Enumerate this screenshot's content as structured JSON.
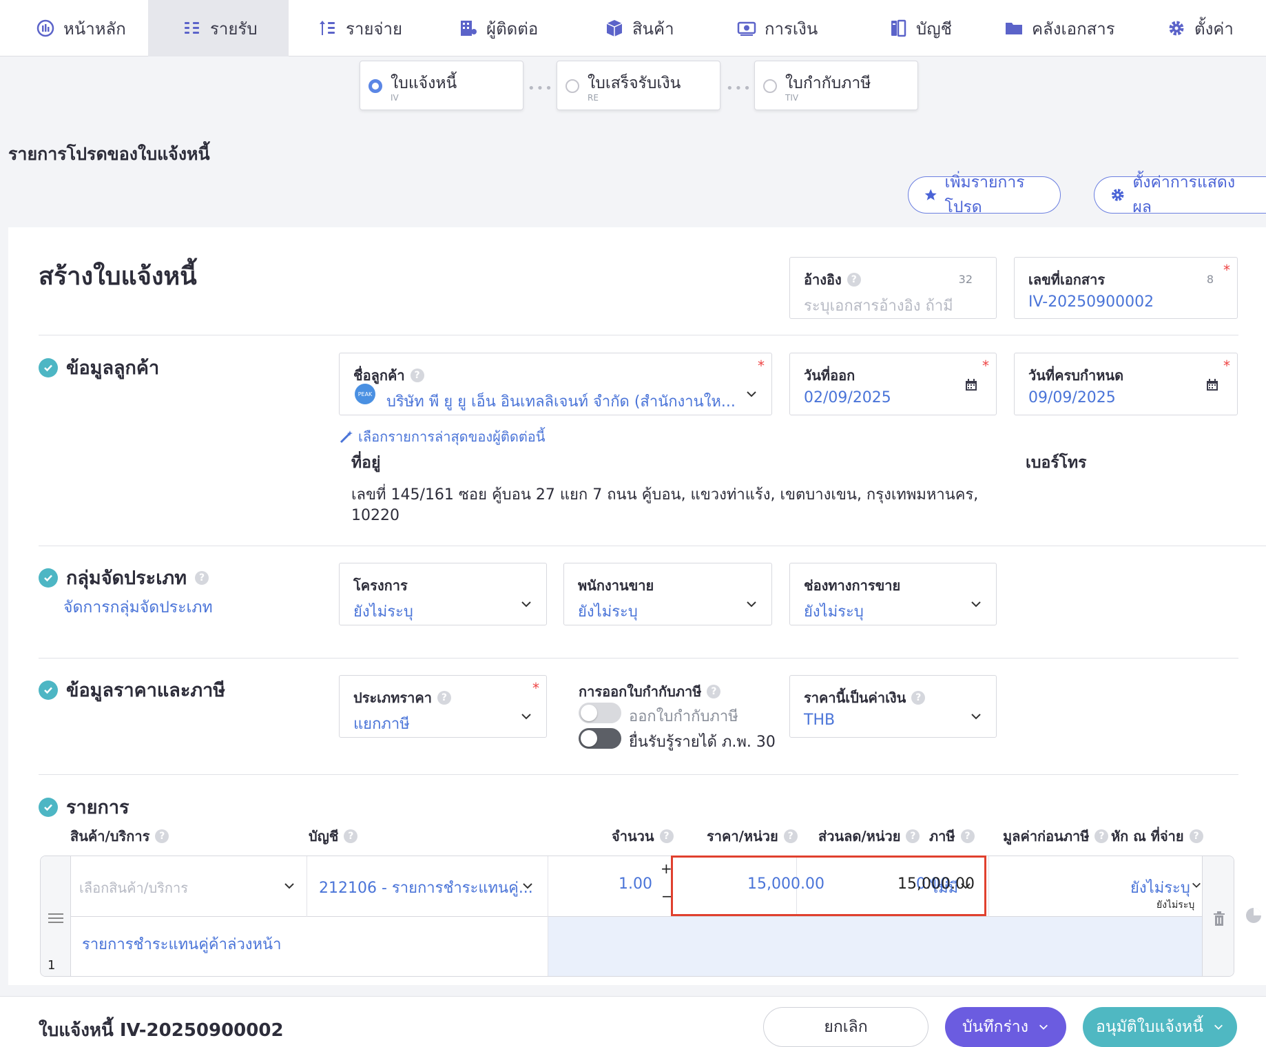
{
  "nav": {
    "items": [
      {
        "label": "หน้าหลัก",
        "icon": "dashboard-icon"
      },
      {
        "label": "รายรับ",
        "icon": "income-icon"
      },
      {
        "label": "รายจ่าย",
        "icon": "expense-icon"
      },
      {
        "label": "ผู้ติดต่อ",
        "icon": "contacts-icon"
      },
      {
        "label": "สินค้า",
        "icon": "box-icon"
      },
      {
        "label": "การเงิน",
        "icon": "money-icon"
      },
      {
        "label": "บัญชี",
        "icon": "ledger-icon"
      },
      {
        "label": "คลังเอกสาร",
        "icon": "folder-icon"
      },
      {
        "label": "ตั้งค่า",
        "icon": "gear-icon"
      }
    ],
    "active": "รายรับ"
  },
  "steps": [
    {
      "label": "ใบแจ้งหนี้",
      "code": "IV",
      "active": true
    },
    {
      "label": "ใบเสร็จรับเงิน",
      "code": "RE",
      "active": false
    },
    {
      "label": "ใบกำกับภาษี",
      "code": "TIV",
      "active": false
    }
  ],
  "favorites": {
    "title": "รายการโปรดของใบแจ้งหนี้",
    "add_label": "เพิ่มรายการโปรด",
    "settings_label": "ตั้งค่าการแสดงผล"
  },
  "page_title": "สร้างใบแจ้งหนี้",
  "header_fields": {
    "reference": {
      "label": "อ้างอิง",
      "placeholder": "ระบุเอกสารอ้างอิง ถ้ามี",
      "count": "32"
    },
    "doc_number": {
      "label": "เลขที่เอกสาร",
      "value": "IV-20250900002",
      "count": "8"
    }
  },
  "customer": {
    "section_title": "ข้อมูลลูกค้า",
    "name_label": "ชื่อลูกค้า",
    "name_value": "บริษัท พี ยู ยู เอ็น อินเทลลิเจนท์ จำกัด (สำนักงานให...",
    "avatar_text": "PEAK",
    "issue_date_label": "วันที่ออก",
    "issue_date": "02/09/2025",
    "due_date_label": "วันที่ครบกำหนด",
    "due_date": "09/09/2025",
    "recent_link": "เลือกรายการล่าสุดของผู้ติดต่อนี้",
    "address_label": "ที่อยู่",
    "address_line1": "เลขที่ 145/161 ซอย คู้บอน 27 แยก 7 ถนน คู้บอน, แขวงท่าแร้ง, เขตบางเขน, กรุงเทพมหานคร,",
    "address_line2": "10220",
    "phone_label": "เบอร์โทร"
  },
  "classification": {
    "section_title": "กลุ่มจัดประเภท",
    "manage_link": "จัดการกลุ่มจัดประเภท",
    "project_label": "โครงการ",
    "project_value": "ยังไม่ระบุ",
    "salesperson_label": "พนักงานขาย",
    "salesperson_value": "ยังไม่ระบุ",
    "channel_label": "ช่องทางการขาย",
    "channel_value": "ยังไม่ระบุ"
  },
  "pricing": {
    "section_title": "ข้อมูลราคาและภาษี",
    "price_type_label": "ประเภทราคา",
    "price_type_value": "แยกภาษี",
    "tax_invoice_label": "การออกใบกำกับภาษี",
    "toggle1_label": "ออกใบกำกับภาษี",
    "toggle2_label": "ยื่นรับรู้รายได้ ภ.พ. 30",
    "currency_label": "ราคานี้เป็นค่าเงิน",
    "currency_value": "THB"
  },
  "items": {
    "section_title": "รายการ",
    "headers": {
      "product": "สินค้า/บริการ",
      "account": "บัญชี",
      "quantity": "จำนวน",
      "unit_price": "ราคา/หน่วย",
      "discount": "ส่วนลด/หน่วย",
      "tax": "ภาษี",
      "pre_tax": "มูลค่าก่อนภาษี",
      "withholding": "หัก ณ ที่จ่าย"
    },
    "rows": [
      {
        "index": "1",
        "product_placeholder": "เลือกสินค้า/บริการ",
        "account": "212106 - รายการชำระแทนคู่...",
        "quantity": "1.00",
        "unit_price": "15,000.00",
        "discount": "0.00",
        "tax": "ไม่มี",
        "pre_tax": "15,000.00",
        "withholding": "ยังไม่ระบุ",
        "withholding_sub": "ยังไม่ระบุ",
        "description": "รายการชำระแทนคู่ค้าล่วงหน้า"
      }
    ]
  },
  "bottom": {
    "doc_label": "ใบแจ้งหนี้ IV-20250900002",
    "cancel": "ยกเลิก",
    "save_draft": "บันทึกร่าง",
    "approve": "อนุมัติใบแจ้งหนี้"
  },
  "colors": {
    "accent": "#4a74d8",
    "primary_button": "#6b5ce0",
    "approve_button": "#4fb8c2",
    "highlight_border": "#e0402e",
    "check": "#4db6c4"
  }
}
